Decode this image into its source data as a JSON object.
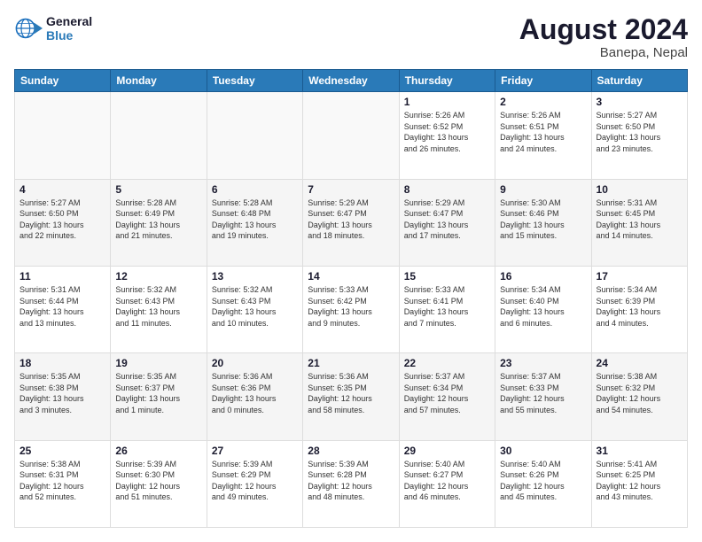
{
  "logo": {
    "line1": "General",
    "line2": "Blue"
  },
  "title": "August 2024",
  "subtitle": "Banepa, Nepal",
  "days_of_week": [
    "Sunday",
    "Monday",
    "Tuesday",
    "Wednesday",
    "Thursday",
    "Friday",
    "Saturday"
  ],
  "weeks": [
    [
      {
        "day": "",
        "info": ""
      },
      {
        "day": "",
        "info": ""
      },
      {
        "day": "",
        "info": ""
      },
      {
        "day": "",
        "info": ""
      },
      {
        "day": "1",
        "info": "Sunrise: 5:26 AM\nSunset: 6:52 PM\nDaylight: 13 hours\nand 26 minutes."
      },
      {
        "day": "2",
        "info": "Sunrise: 5:26 AM\nSunset: 6:51 PM\nDaylight: 13 hours\nand 24 minutes."
      },
      {
        "day": "3",
        "info": "Sunrise: 5:27 AM\nSunset: 6:50 PM\nDaylight: 13 hours\nand 23 minutes."
      }
    ],
    [
      {
        "day": "4",
        "info": "Sunrise: 5:27 AM\nSunset: 6:50 PM\nDaylight: 13 hours\nand 22 minutes."
      },
      {
        "day": "5",
        "info": "Sunrise: 5:28 AM\nSunset: 6:49 PM\nDaylight: 13 hours\nand 21 minutes."
      },
      {
        "day": "6",
        "info": "Sunrise: 5:28 AM\nSunset: 6:48 PM\nDaylight: 13 hours\nand 19 minutes."
      },
      {
        "day": "7",
        "info": "Sunrise: 5:29 AM\nSunset: 6:47 PM\nDaylight: 13 hours\nand 18 minutes."
      },
      {
        "day": "8",
        "info": "Sunrise: 5:29 AM\nSunset: 6:47 PM\nDaylight: 13 hours\nand 17 minutes."
      },
      {
        "day": "9",
        "info": "Sunrise: 5:30 AM\nSunset: 6:46 PM\nDaylight: 13 hours\nand 15 minutes."
      },
      {
        "day": "10",
        "info": "Sunrise: 5:31 AM\nSunset: 6:45 PM\nDaylight: 13 hours\nand 14 minutes."
      }
    ],
    [
      {
        "day": "11",
        "info": "Sunrise: 5:31 AM\nSunset: 6:44 PM\nDaylight: 13 hours\nand 13 minutes."
      },
      {
        "day": "12",
        "info": "Sunrise: 5:32 AM\nSunset: 6:43 PM\nDaylight: 13 hours\nand 11 minutes."
      },
      {
        "day": "13",
        "info": "Sunrise: 5:32 AM\nSunset: 6:43 PM\nDaylight: 13 hours\nand 10 minutes."
      },
      {
        "day": "14",
        "info": "Sunrise: 5:33 AM\nSunset: 6:42 PM\nDaylight: 13 hours\nand 9 minutes."
      },
      {
        "day": "15",
        "info": "Sunrise: 5:33 AM\nSunset: 6:41 PM\nDaylight: 13 hours\nand 7 minutes."
      },
      {
        "day": "16",
        "info": "Sunrise: 5:34 AM\nSunset: 6:40 PM\nDaylight: 13 hours\nand 6 minutes."
      },
      {
        "day": "17",
        "info": "Sunrise: 5:34 AM\nSunset: 6:39 PM\nDaylight: 13 hours\nand 4 minutes."
      }
    ],
    [
      {
        "day": "18",
        "info": "Sunrise: 5:35 AM\nSunset: 6:38 PM\nDaylight: 13 hours\nand 3 minutes."
      },
      {
        "day": "19",
        "info": "Sunrise: 5:35 AM\nSunset: 6:37 PM\nDaylight: 13 hours\nand 1 minute."
      },
      {
        "day": "20",
        "info": "Sunrise: 5:36 AM\nSunset: 6:36 PM\nDaylight: 13 hours\nand 0 minutes."
      },
      {
        "day": "21",
        "info": "Sunrise: 5:36 AM\nSunset: 6:35 PM\nDaylight: 12 hours\nand 58 minutes."
      },
      {
        "day": "22",
        "info": "Sunrise: 5:37 AM\nSunset: 6:34 PM\nDaylight: 12 hours\nand 57 minutes."
      },
      {
        "day": "23",
        "info": "Sunrise: 5:37 AM\nSunset: 6:33 PM\nDaylight: 12 hours\nand 55 minutes."
      },
      {
        "day": "24",
        "info": "Sunrise: 5:38 AM\nSunset: 6:32 PM\nDaylight: 12 hours\nand 54 minutes."
      }
    ],
    [
      {
        "day": "25",
        "info": "Sunrise: 5:38 AM\nSunset: 6:31 PM\nDaylight: 12 hours\nand 52 minutes."
      },
      {
        "day": "26",
        "info": "Sunrise: 5:39 AM\nSunset: 6:30 PM\nDaylight: 12 hours\nand 51 minutes."
      },
      {
        "day": "27",
        "info": "Sunrise: 5:39 AM\nSunset: 6:29 PM\nDaylight: 12 hours\nand 49 minutes."
      },
      {
        "day": "28",
        "info": "Sunrise: 5:39 AM\nSunset: 6:28 PM\nDaylight: 12 hours\nand 48 minutes."
      },
      {
        "day": "29",
        "info": "Sunrise: 5:40 AM\nSunset: 6:27 PM\nDaylight: 12 hours\nand 46 minutes."
      },
      {
        "day": "30",
        "info": "Sunrise: 5:40 AM\nSunset: 6:26 PM\nDaylight: 12 hours\nand 45 minutes."
      },
      {
        "day": "31",
        "info": "Sunrise: 5:41 AM\nSunset: 6:25 PM\nDaylight: 12 hours\nand 43 minutes."
      }
    ]
  ]
}
